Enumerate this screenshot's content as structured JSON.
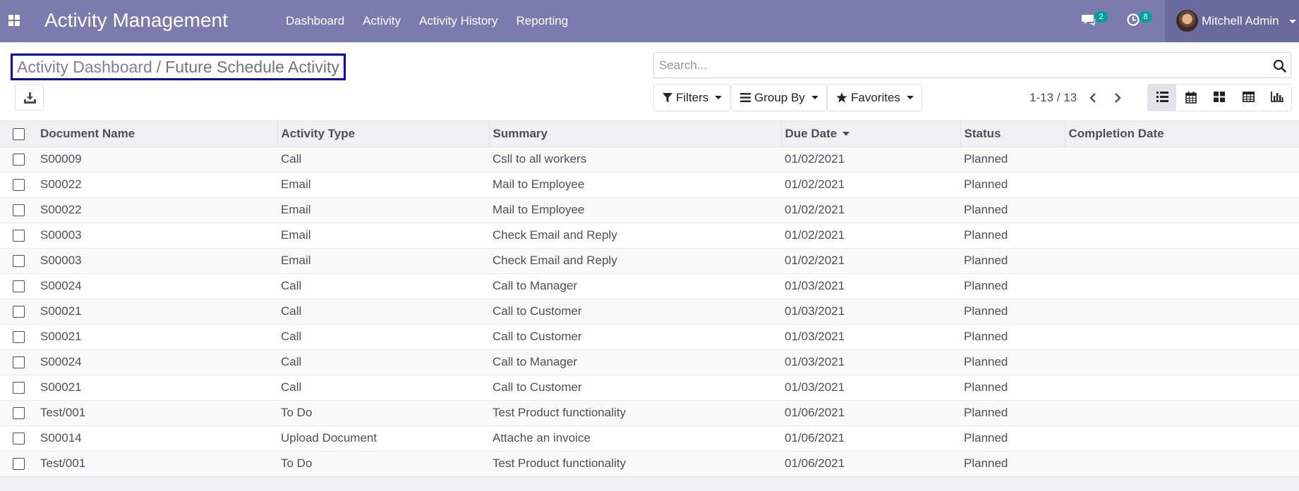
{
  "navbar": {
    "brand": "Activity Management",
    "menu": [
      "Dashboard",
      "Activity",
      "Activity History",
      "Reporting"
    ],
    "messages_count": "2",
    "activities_count": "8",
    "user_name": "Mitchell Admin"
  },
  "breadcrumb": {
    "parent": "Activity Dashboard",
    "separator": "/",
    "current": "Future Schedule Activity"
  },
  "search": {
    "placeholder": "Search..."
  },
  "filters": {
    "filters_label": "Filters",
    "group_by_label": "Group By",
    "favorites_label": "Favorites"
  },
  "pager": {
    "value": "1-13 / 13"
  },
  "views": [
    "list-view-icon",
    "calendar-view-icon",
    "kanban-view-icon",
    "pivot-view-icon",
    "graph-view-icon"
  ],
  "colors": {
    "navbar": "#7c7bad",
    "accent": "#00a09d",
    "highlight_border": "#0000cc"
  },
  "table": {
    "columns": [
      "Document Name",
      "Activity Type",
      "Summary",
      "Due Date",
      "Status",
      "Completion Date"
    ],
    "sorted_column": "Due Date",
    "rows": [
      [
        "S00009",
        "Call",
        "Csll to all workers",
        "01/02/2021",
        "Planned",
        ""
      ],
      [
        "S00022",
        "Email",
        "Mail to Employee",
        "01/02/2021",
        "Planned",
        ""
      ],
      [
        "S00022",
        "Email",
        "Mail to Employee",
        "01/02/2021",
        "Planned",
        ""
      ],
      [
        "S00003",
        "Email",
        "Check Email and Reply",
        "01/02/2021",
        "Planned",
        ""
      ],
      [
        "S00003",
        "Email",
        "Check Email and Reply",
        "01/02/2021",
        "Planned",
        ""
      ],
      [
        "S00024",
        "Call",
        "Call to Manager",
        "01/03/2021",
        "Planned",
        ""
      ],
      [
        "S00021",
        "Call",
        "Call to Customer",
        "01/03/2021",
        "Planned",
        ""
      ],
      [
        "S00021",
        "Call",
        "Call to Customer",
        "01/03/2021",
        "Planned",
        ""
      ],
      [
        "S00024",
        "Call",
        "Call to Manager",
        "01/03/2021",
        "Planned",
        ""
      ],
      [
        "S00021",
        "Call",
        "Call to Customer",
        "01/03/2021",
        "Planned",
        ""
      ],
      [
        "Test/001",
        "To Do",
        "Test Product functionality",
        "01/06/2021",
        "Planned",
        ""
      ],
      [
        "S00014",
        "Upload Document",
        "Attache an invoice",
        "01/06/2021",
        "Planned",
        ""
      ],
      [
        "Test/001",
        "To Do",
        "Test Product functionality",
        "01/06/2021",
        "Planned",
        ""
      ]
    ]
  }
}
